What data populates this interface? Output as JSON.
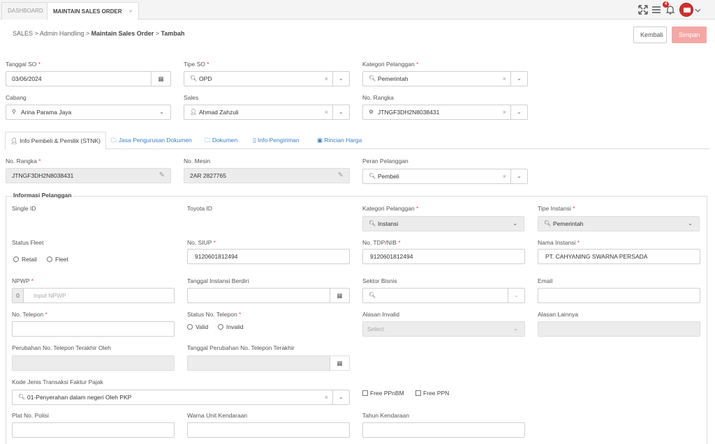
{
  "tabs": {
    "dashboard": "DASHBOARD",
    "active": "MAINTAIN SALES ORDER",
    "close": "×"
  },
  "notifications": {
    "count": "4"
  },
  "breadcrumb": {
    "b1": "SALES",
    "b2": "Admin Handling",
    "b3": "Maintain Sales Order",
    "b4": "Tambah",
    "sep": ">"
  },
  "actions": {
    "back": "Kembali",
    "save": "Simpan"
  },
  "header": {
    "tanggal_so": {
      "label": "Tanggal SO",
      "value": "03/06/2024"
    },
    "tipe_so": {
      "label": "Tipe SO",
      "value": "OPD"
    },
    "kategori": {
      "label": "Kategori Pelanggan",
      "value": "Pemerintah"
    },
    "cabang": {
      "label": "Cabang",
      "value": "Arina Parama Jaya"
    },
    "sales": {
      "label": "Sales",
      "value": "Ahmad Zahzuli"
    },
    "no_rangka": {
      "label": "No. Rangka",
      "value": "JTNGF3DH2N8038431"
    }
  },
  "detail_tabs": [
    "Info Pembeli & Pemilik (STNK)",
    "Jasa Pengurusan Dokumen",
    "Dokumen",
    "Info Pengiriman",
    "Rincian Harga"
  ],
  "vehicle": {
    "no_rangka": {
      "label": "No. Rangka",
      "value": "JTNGF3DH2N8038431"
    },
    "no_mesin": {
      "label": "No. Mesin",
      "value": "2AR 2827765"
    },
    "peran": {
      "label": "Peran Pelanggan",
      "value": "Pembeli"
    }
  },
  "info": {
    "legend": "Informasi Pelanggan",
    "single_id": {
      "label": "Single ID"
    },
    "toyota_id": {
      "label": "Toyota ID"
    },
    "kategori": {
      "label": "Kategori Pelanggan",
      "value": "Instansi"
    },
    "tipe_instansi": {
      "label": "Tipe Instansi",
      "value": "Pemerintah"
    },
    "status_fleet": {
      "label": "Status Fleet",
      "options": [
        "Retail",
        "Fleet"
      ]
    },
    "no_siup": {
      "label": "No. SIUP",
      "value": "9120601812494"
    },
    "no_tdp": {
      "label": "No. TDP/NIB",
      "value": "9120601812494"
    },
    "nama_instansi": {
      "label": "Nama Instansi",
      "value": "PT. CAHYANING SWARNA PERSADA"
    },
    "npwp": {
      "label": "NPWP",
      "prefix": "0",
      "placeholder": "Input NPWP"
    },
    "tgl_berdiri": {
      "label": "Tanggal Instansi Berdiri"
    },
    "sektor": {
      "label": "Sektor Bisnis"
    },
    "email": {
      "label": "Email"
    },
    "no_telepon": {
      "label": "No. Telepon"
    },
    "status_telepon": {
      "label": "Status No. Telepon",
      "options": [
        "Valid",
        "Invalid"
      ]
    },
    "alasan_invalid": {
      "label": "Alasan Invalid",
      "placeholder": "Select"
    },
    "alasan_lainnya": {
      "label": "Alasan Lainnya"
    },
    "perubahan_oleh": {
      "label": "Perubahan No. Telepon Terakhir Oleh"
    },
    "tgl_perubahan": {
      "label": "Tanggal Perubahan No. Telepon Terakhir"
    },
    "kode_faktur": {
      "label": "Kode Jenis Transaksi Faktur Pajak",
      "value": "01-Penyerahan dalam negeri Oleh PKP"
    },
    "free_ppnbm": "Free PPnBM",
    "free_ppn": "Free PPN",
    "plat": {
      "label": "Plat No. Polisi"
    },
    "warna": {
      "label": "Warna Unit Kendaraan"
    },
    "tahun": {
      "label": "Tahun Kendaraan"
    }
  },
  "req_mark": "*"
}
